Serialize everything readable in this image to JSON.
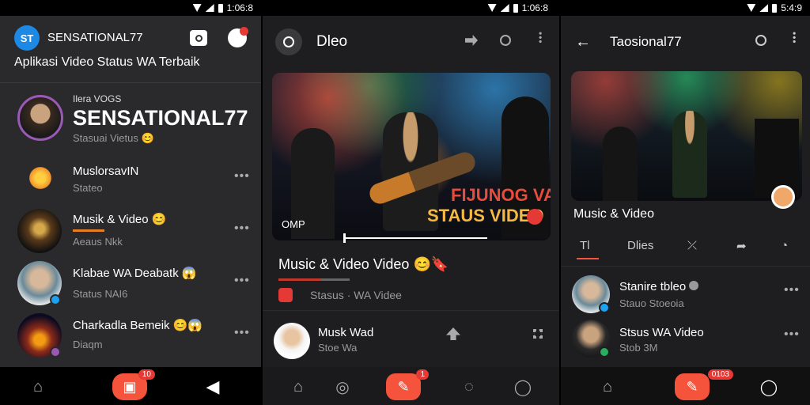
{
  "panel1": {
    "status_time": "1:06:8",
    "app_logo": "ST",
    "app_name": "SENSATIONAL77",
    "app_subtitle": "Aplikasi Video Status WA Terbaik",
    "featured": {
      "small_label": "Ilera VOGS",
      "big_title": "SENSATIONAL77",
      "subtext": "Stasuai Vietus"
    },
    "list": [
      {
        "title": "MuslorsavIN",
        "sub": "Stateo"
      },
      {
        "title": "Musik & Video",
        "sub": "Aeaus Nkk"
      },
      {
        "title": "Klabae WA Deabatk",
        "sub": "Status NAI6"
      },
      {
        "title": "Charkadla Bemeik",
        "sub": "Diaqm"
      }
    ],
    "nav_badge": "10"
  },
  "panel2": {
    "status_time": "1:06:8",
    "header_title": "Dleo",
    "video_overlay_line1": "FIJUNOG VA",
    "video_overlay_line2": "STAUS VIDEO",
    "video_corner": "OMP",
    "video_title": "Music & Video Video",
    "meta_text": "Stasus · WA Videe",
    "user_name": "Musk Wad",
    "user_sub": "Stoe Wa",
    "nav_badge": "1"
  },
  "panel3": {
    "status_time": "5:4:9",
    "header_title": "Taosional77",
    "video_caption": "Music & Video",
    "tabs": [
      "Tl",
      "Dlies"
    ],
    "list": [
      {
        "title": "Stanire tbleo",
        "sub": "Stauo Stoeoia"
      },
      {
        "title": "Stsus WA Video",
        "sub": "Stob 3M"
      }
    ],
    "nav_badge": "0103"
  },
  "colors": {
    "accent": "#f5533b",
    "badge": "#e53935",
    "gold": "#f5b942"
  }
}
